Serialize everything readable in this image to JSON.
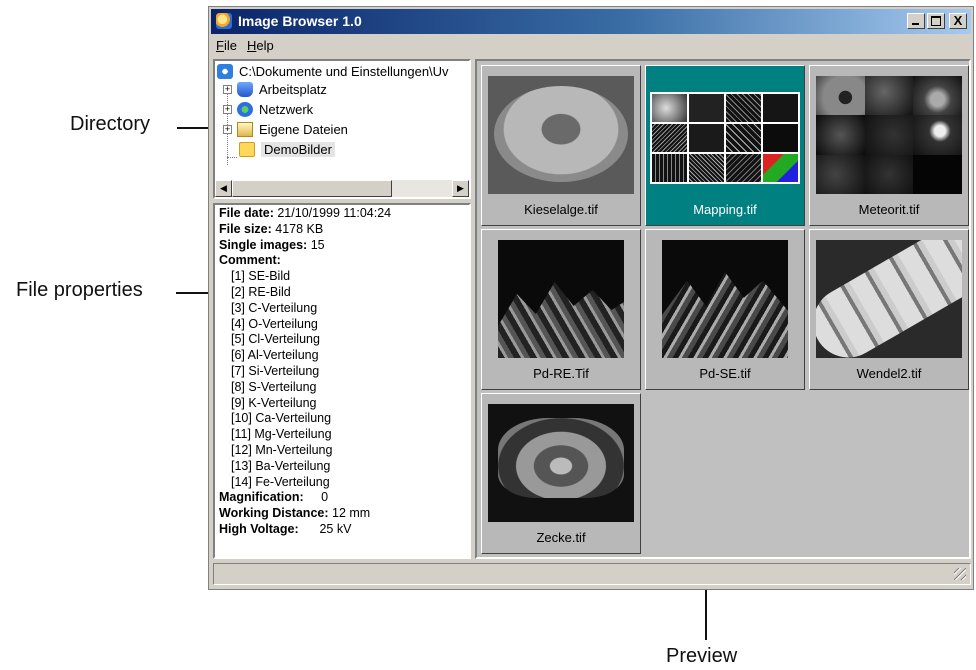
{
  "callouts": {
    "directory": "Directory",
    "file_properties": "File properties",
    "preview": "Preview"
  },
  "window": {
    "title": "Image Browser 1.0",
    "buttons": [
      "minimize",
      "maximize",
      "close"
    ],
    "close_glyph": "X"
  },
  "menu": {
    "file": {
      "accel": "F",
      "rest": "ile"
    },
    "help": {
      "accel": "H",
      "rest": "elp"
    }
  },
  "tree": {
    "root": "C:\\Dokumente und Einstellungen\\Uv",
    "items": [
      {
        "label": "Arbeitsplatz",
        "icon": "computer-icon"
      },
      {
        "label": "Netzwerk",
        "icon": "network-icon"
      },
      {
        "label": "Eigene Dateien",
        "icon": "documents-icon"
      },
      {
        "label": "DemoBilder",
        "icon": "folder-icon",
        "selected": true
      }
    ]
  },
  "properties": {
    "file_date_label": "File date:",
    "file_date": "21/10/1999 11:04:24",
    "file_size_label": "File size:",
    "file_size": "4178 KB",
    "single_images_label": "Single images:",
    "single_images": "15",
    "comment_label": "Comment:",
    "comments": [
      "[1] SE-Bild",
      "[2] RE-Bild",
      "[3] C-Verteilung",
      "[4] O-Verteilung",
      "[5] Cl-Verteilung",
      "[6] Al-Verteilung",
      "[7] Si-Verteilung",
      "[8] S-Verteilung",
      "[9] K-Verteilung",
      "[10] Ca-Verteilung",
      "[11] Mg-Verteilung",
      "[12] Mn-Verteilung",
      "[13] Ba-Verteilung",
      "[14] Fe-Verteilung"
    ],
    "magnification_label": "Magnification:",
    "magnification": "0",
    "working_distance_label": "Working Distance:",
    "working_distance": "12 mm",
    "high_voltage_label": "High Voltage:",
    "high_voltage": "25 kV"
  },
  "thumbnails": [
    {
      "name": "Kieselalge.tif",
      "selected": false
    },
    {
      "name": "Mapping.tif",
      "selected": true
    },
    {
      "name": "Meteorit.tif",
      "selected": false
    },
    {
      "name": "Pd-RE.Tif",
      "selected": false
    },
    {
      "name": "Pd-SE.tif",
      "selected": false
    },
    {
      "name": "Wendel2.tif",
      "selected": false
    },
    {
      "name": "Zecke.tif",
      "selected": false
    }
  ],
  "colors": {
    "selection": "#008080",
    "titlebar": "#0a246a"
  }
}
